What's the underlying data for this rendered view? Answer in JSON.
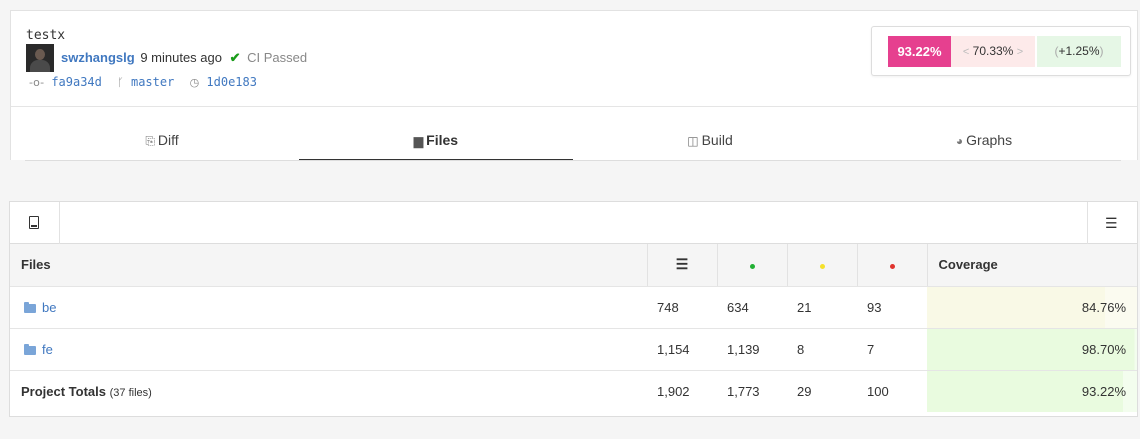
{
  "commit": {
    "message": "testx",
    "author": "swzhangslg",
    "time": "9 minutes ago",
    "ci_check": "✔",
    "ci_status": "CI Passed",
    "commit_icon": "commit-icon",
    "commit_id": "fa9a34d",
    "branch_icon": "branch-icon",
    "branch": "master",
    "parent_icon": "parent-commit-icon",
    "parent_id": "1d0e183"
  },
  "coverage": {
    "value": "93.22%",
    "base": "70.33%",
    "base_left": "<",
    "base_right": ">",
    "delta": "+1.25%",
    "delta_open": "(",
    "delta_close": ")",
    "colors": {
      "main": "#e6408f",
      "base": "#fdeaea",
      "delta": "#e6f7e6"
    }
  },
  "tabs": [
    {
      "label": "Diff",
      "icon": "diff-icon",
      "glyph": "⎘",
      "active": false
    },
    {
      "label": "Files",
      "icon": "folder-icon",
      "glyph": "▆",
      "active": true
    },
    {
      "label": "Build",
      "icon": "box-icon",
      "glyph": "◫",
      "active": false
    },
    {
      "label": "Graphs",
      "icon": "pie-chart-icon",
      "glyph": "◕",
      "active": false
    }
  ],
  "toolbar": {
    "left_icon": "book-icon",
    "right_icon": "list-settings-icon",
    "right_glyph": "☰"
  },
  "table": {
    "headers": {
      "name": "Files",
      "lines_icon": "☰",
      "hits_color": "#21b033",
      "partials_color": "#f5e12b",
      "misses_color": "#e0332d",
      "coverage": "Coverage"
    },
    "rows": [
      {
        "name": "be",
        "lines": "748",
        "hits": "634",
        "partials": "21",
        "misses": "93",
        "coverage": "84.76%",
        "coverage_value": 84.76
      },
      {
        "name": "fe",
        "lines": "1,154",
        "hits": "1,139",
        "partials": "8",
        "misses": "7",
        "coverage": "98.70%",
        "coverage_value": 98.7
      }
    ],
    "totals": {
      "label": "Project Totals",
      "file_count": "(37 files)",
      "lines": "1,902",
      "hits": "1,773",
      "partials": "29",
      "misses": "100",
      "coverage": "93.22%",
      "coverage_value": 93.22
    }
  }
}
